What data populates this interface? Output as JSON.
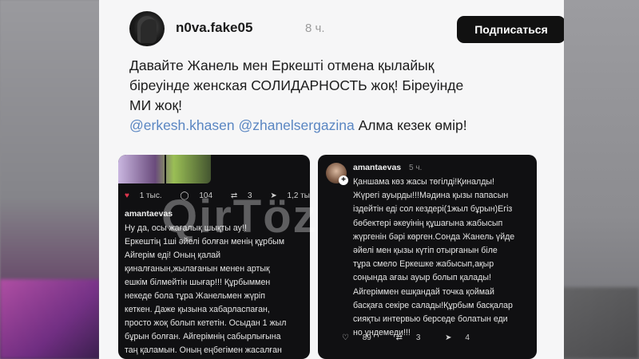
{
  "post": {
    "username": "n0va.fake05",
    "time": "8 ч.",
    "subscribe_label": "Подписаться",
    "text_line1": "Давайте Жанель мен Еркешті отмена қылайық",
    "text_line2": "біреуінде женская СОЛИДАРНОСТЬ жоқ! Біреуінде",
    "text_line3": "МИ жоқ!",
    "mention1": "@erkesh.khasen",
    "mention2": "@zhanelsergazina",
    "mention_tail": "Алма кезек өмір!"
  },
  "left_panel": {
    "likes": "1 тыс.",
    "comments": "104",
    "reposts": "3",
    "shares": "1,2 тыс.",
    "comment_user": "amantaevas",
    "comment_lines": [
      "Ну да, осы жағалық шықты ау!!",
      "Еркештің 1ші әйелі болған менің құрбым",
      "Айгерім еді! Оның қалай",
      "қиналғанын,жылағанын менен артық",
      "ешкім білмейтін шығар!!! Құрбыммен",
      "некеде бола тұра Жанельмен жүріп",
      "кеткен. Даже қызына хабарласпаған,",
      "просто жоқ болып кететін. Осыдан 1 жыл",
      "бұрын болған. Айгерімнің сабырлығына",
      "таң қаламын. Оның еңбегімен жасалған"
    ]
  },
  "right_panel": {
    "user": "amantaevas",
    "time": "5 ч.",
    "lines": [
      "Қаншама көз жасы төгілді!Қиналды!",
      "Жүрегі ауырды!!!Мәдина қызы папасын",
      "іздейтін еді сол кездері(1жыл бұрын)Егіз",
      "бөбектері әкеуінің құшағына жабысып",
      "жүргенін бәрі көрген.Сонда Жанель үйде",
      "әйелі мен қызы күтіп отырғанын біле",
      "тұра смело Еркешке жабысып,ақыр",
      "соңында ағаы ауыр болып қалады!",
      "Айгеріммен ешқандай точка қоймай",
      "басқаға секіре салады!Құрбым басқалар",
      "сияқты интервью берседе болатын еди",
      "но үндемеди!!!"
    ],
    "likes": "89",
    "reposts": "3",
    "shares": "4"
  },
  "watermark": "QirTöz"
}
